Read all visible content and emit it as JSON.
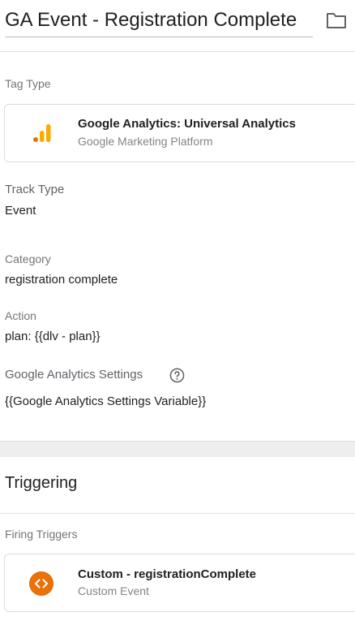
{
  "header": {
    "title": "GA Event - Registration Complete",
    "folder_icon": "folder-icon"
  },
  "tag_config": {
    "tag_type_label": "Tag Type",
    "tag_type": {
      "title": "Google Analytics: Universal Analytics",
      "subtitle": "Google Marketing Platform",
      "icon": "google-analytics-icon",
      "icon_colors": [
        "#e8710a",
        "#f9ab00",
        "#f9ab00"
      ]
    },
    "track_type_label": "Track Type",
    "track_type_value": "Event",
    "category_label": "Category",
    "category_value": "registration complete",
    "action_label": "Action",
    "action_value": "plan: {{dlv - plan}}",
    "ga_settings_label": "Google Analytics Settings",
    "ga_settings_help_icon": "help-icon",
    "ga_settings_value": "{{Google Analytics Settings Variable}}"
  },
  "triggering": {
    "section_title": "Triggering",
    "firing_triggers_label": "Firing Triggers",
    "trigger": {
      "title": "Custom - registrationComplete",
      "subtitle": "Custom Event",
      "icon": "custom-event-icon",
      "icon_color": "#e8710a"
    }
  }
}
